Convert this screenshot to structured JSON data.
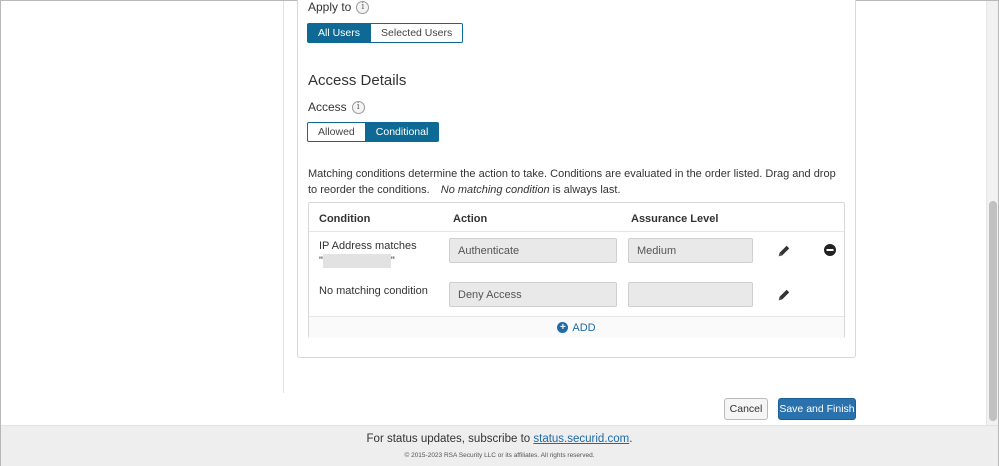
{
  "apply_to": {
    "label": "Apply to",
    "info": "i",
    "options": [
      "All Users",
      "Selected Users"
    ],
    "selected": "All Users"
  },
  "access_details": {
    "title": "Access Details",
    "access_label": "Access",
    "info": "i",
    "options": [
      "Allowed",
      "Conditional"
    ],
    "selected": "Conditional"
  },
  "description": {
    "text": "Matching conditions determine the action to take. Conditions are evaluated in the order listed. Drag and drop to reorder the conditions.",
    "emphasis": "No matching condition",
    "suffix": "is always last."
  },
  "table": {
    "headers": {
      "condition": "Condition",
      "action": "Action",
      "assurance": "Assurance Level"
    },
    "rows": [
      {
        "condition_line1": "IP Address matches",
        "quote_open": "\"",
        "quote_close": "\"",
        "action": "Authenticate",
        "assurance": "Medium"
      },
      {
        "condition_line1": "No matching condition",
        "action": "Deny Access",
        "assurance": ""
      }
    ],
    "add_label": "ADD"
  },
  "buttons": {
    "cancel": "Cancel",
    "save": "Save and Finish"
  },
  "footer": {
    "status_prefix": "For status updates, subscribe to",
    "status_link": "status.securid.com",
    "status_suffix": ".",
    "copyright": "© 2015-2023 RSA Security LLC or its affiliates. All rights reserved."
  },
  "colors": {
    "primary": "#0e6a95",
    "save_button": "#2a72ad",
    "link": "#1f6aa8",
    "footer_bg": "#eeeeee"
  }
}
